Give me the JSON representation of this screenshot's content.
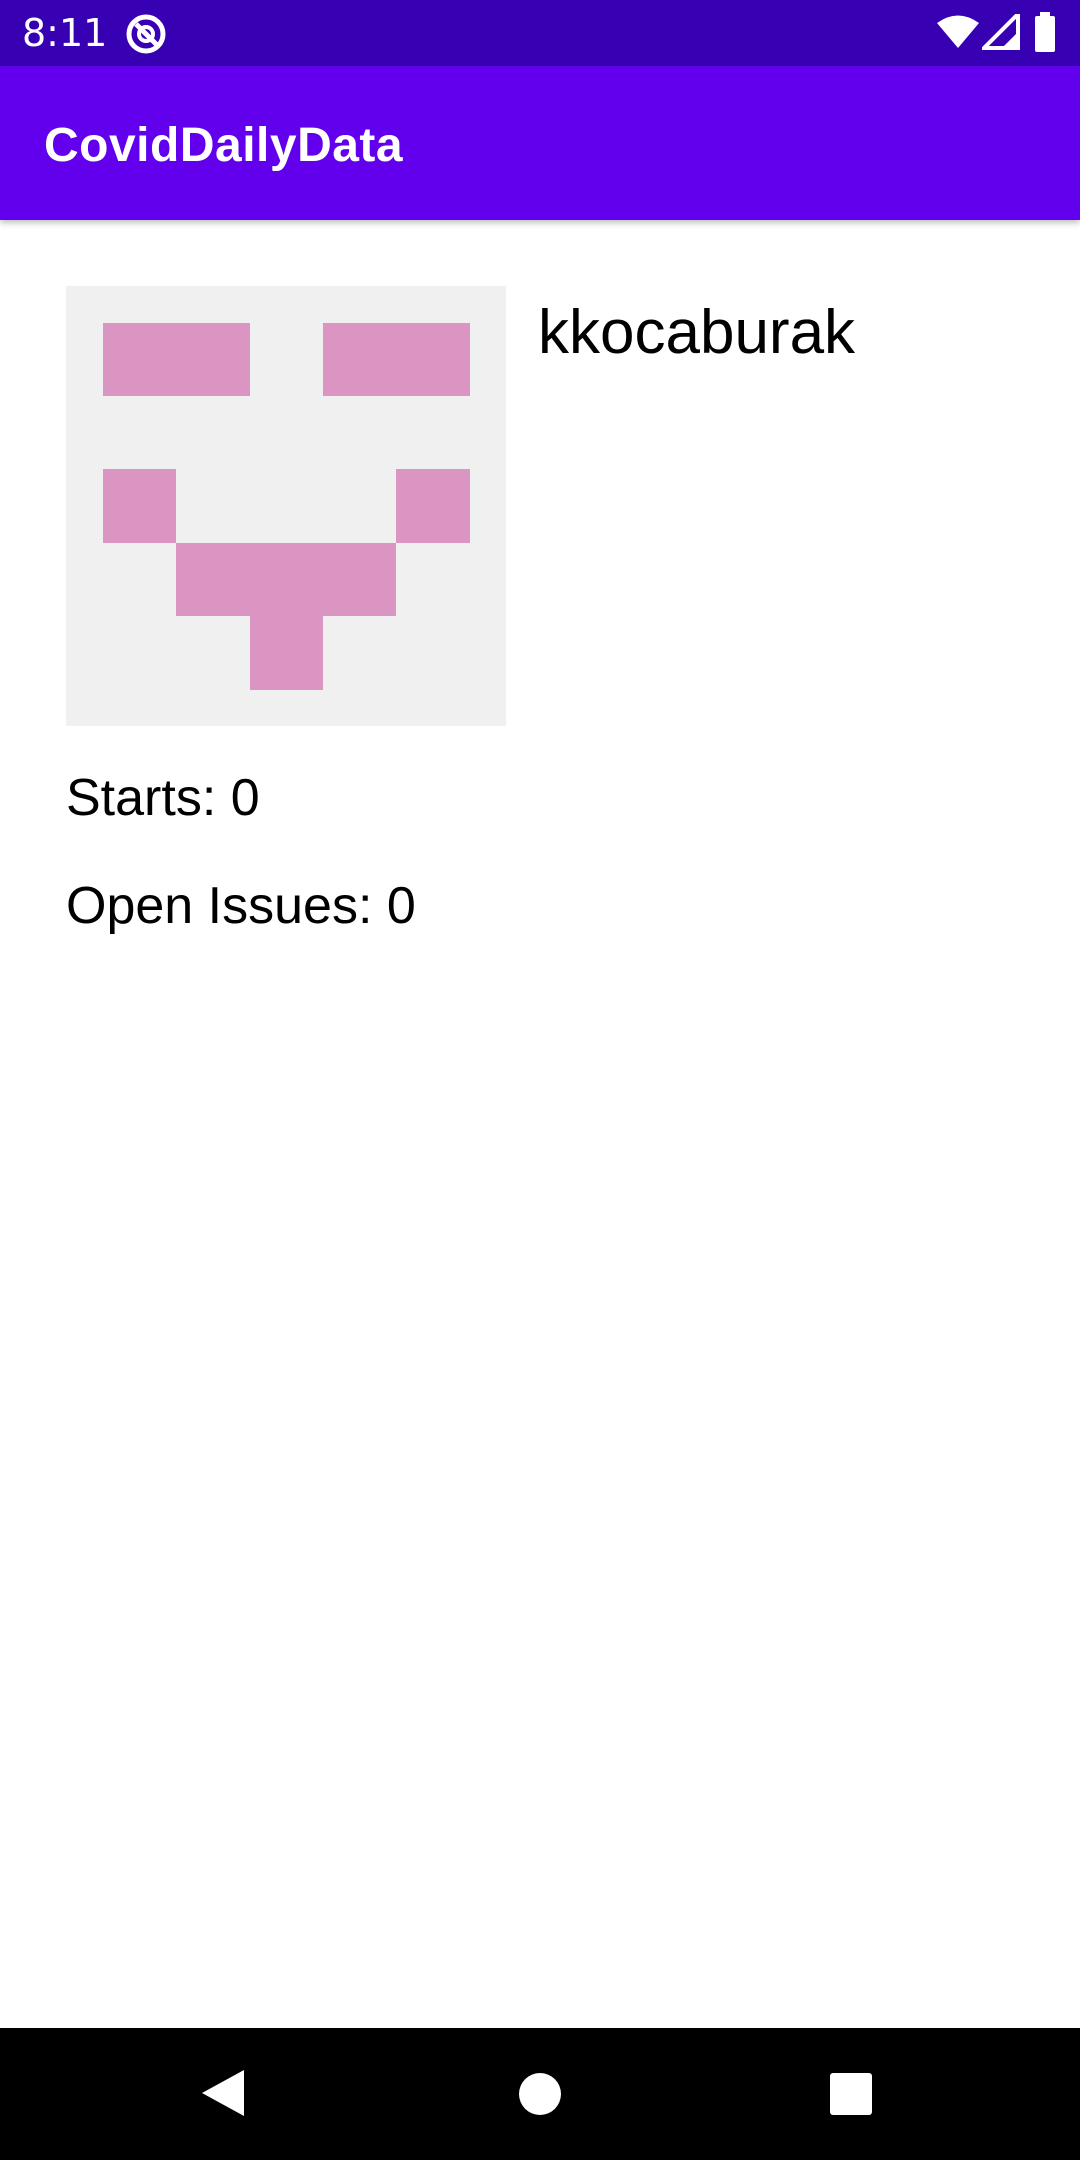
{
  "status_bar": {
    "time": "8:11",
    "background_color": "#3700b3",
    "icons": [
      "app-notification-icon",
      "wifi-icon",
      "cell-signal-icon",
      "battery-icon"
    ]
  },
  "app_bar": {
    "title": "CovidDailyData",
    "background_color": "#6200ee"
  },
  "profile": {
    "avatar": {
      "description": "identicon",
      "background_color": "#f0f0f0",
      "pixel_color": "#da95c2"
    },
    "username": "kkocaburak",
    "stars_label": "Starts: 0",
    "open_issues_label": "Open Issues: 0"
  },
  "nav_bar": {
    "icons": [
      "back-icon",
      "home-icon",
      "recents-icon"
    ]
  }
}
